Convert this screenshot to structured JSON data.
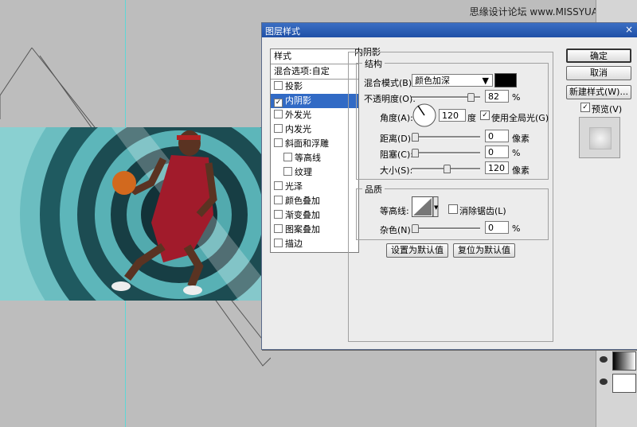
{
  "watermark": "思缘设计论坛 www.MISSYUAN.COM",
  "dialog": {
    "title": "图层样式",
    "close": "×",
    "styles_header": "样式",
    "blend_options": "混合选项:自定",
    "items": [
      {
        "label": "投影",
        "checked": false
      },
      {
        "label": "内阴影",
        "checked": true
      },
      {
        "label": "外发光",
        "checked": false
      },
      {
        "label": "内发光",
        "checked": false
      },
      {
        "label": "斜面和浮雕",
        "checked": false
      },
      {
        "label": "等高线",
        "checked": false
      },
      {
        "label": "纹理",
        "checked": false
      },
      {
        "label": "光泽",
        "checked": false
      },
      {
        "label": "颜色叠加",
        "checked": false
      },
      {
        "label": "渐变叠加",
        "checked": false
      },
      {
        "label": "图案叠加",
        "checked": false
      },
      {
        "label": "描边",
        "checked": false
      }
    ],
    "section_title": "内阴影",
    "structure": {
      "title": "结构",
      "blend_mode_label": "混合模式(B):",
      "blend_mode_value": "颜色加深",
      "shadow_color": "#000000",
      "opacity_label": "不透明度(O):",
      "opacity_value": "82",
      "opacity_unit": "%",
      "angle_label": "角度(A):",
      "angle_value": "120",
      "angle_unit": "度",
      "global_light_label": "使用全局光(G)",
      "global_light_checked": true,
      "distance_label": "距离(D):",
      "distance_value": "0",
      "distance_unit": "像素",
      "choke_label": "阻塞(C):",
      "choke_value": "0",
      "choke_unit": "%",
      "size_label": "大小(S):",
      "size_value": "120",
      "size_unit": "像素"
    },
    "quality": {
      "title": "品质",
      "contour_label": "等高线:",
      "antialias_label": "消除锯齿(L)",
      "antialias_checked": false,
      "noise_label": "杂色(N):",
      "noise_value": "0",
      "noise_unit": "%"
    },
    "make_default": "设置为默认值",
    "reset_default": "复位为默认值",
    "ok": "确定",
    "cancel": "取消",
    "new_style": "新建样式(W)...",
    "preview_label": "预览(V)",
    "preview_checked": true
  }
}
